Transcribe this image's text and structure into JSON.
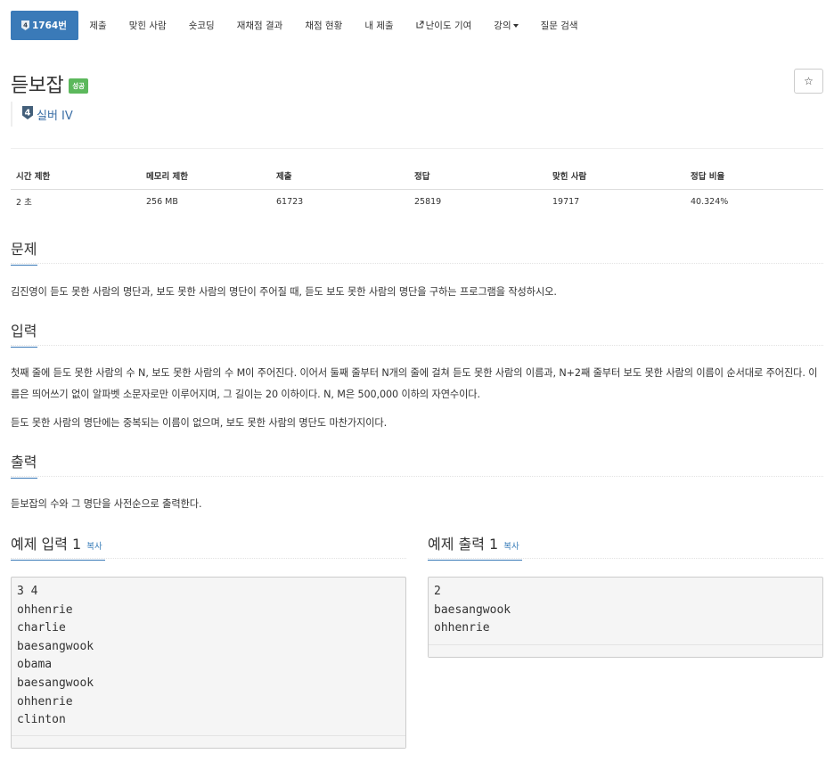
{
  "nav": {
    "problem_number": "1764번",
    "items": [
      "제출",
      "맞힌 사람",
      "숏코딩",
      "재채점 결과",
      "채점 현황",
      "내 제출",
      "난이도 기여",
      "강의",
      "질문 검색"
    ],
    "active_color": "#3a7ab8"
  },
  "problem": {
    "title": "듣보잡",
    "status_badge": "성공",
    "tier_number": "4",
    "tier": "실버 IV",
    "star": "☆"
  },
  "info": {
    "headers": [
      "시간 제한",
      "메모리 제한",
      "제출",
      "정답",
      "맞힌 사람",
      "정답 비율"
    ],
    "values": [
      "2 초",
      "256 MB",
      "61723",
      "25819",
      "19717",
      "40.324%"
    ]
  },
  "sections": {
    "description_title": "문제",
    "description": "김진영이 듣도 못한 사람의 명단과, 보도 못한 사람의 명단이 주어질 때, 듣도 보도 못한 사람의 명단을 구하는 프로그램을 작성하시오.",
    "input_title": "입력",
    "input_p1": "첫째 줄에 듣도 못한 사람의 수 N, 보도 못한 사람의 수 M이 주어진다. 이어서 둘째 줄부터 N개의 줄에 걸쳐 듣도 못한 사람의 이름과, N+2째 줄부터 보도 못한 사람의 이름이 순서대로 주어진다. 이름은 띄어쓰기 없이 알파벳 소문자로만 이루어지며, 그 길이는 20 이하이다. N, M은 500,000 이하의 자연수이다.",
    "input_p2": "듣도 못한 사람의 명단에는 중복되는 이름이 없으며, 보도 못한 사람의 명단도 마찬가지이다.",
    "output_title": "출력",
    "output": "듣보잡의 수와 그 명단을 사전순으로 출력한다."
  },
  "samples": {
    "copy_label": "복사",
    "input_title": "예제 입력 1",
    "input_lines": [
      "3 4",
      "ohhenrie",
      "charlie",
      "baesangwook",
      "obama",
      "baesangwook",
      "ohhenrie",
      "clinton"
    ],
    "output_title": "예제 출력 1",
    "output_lines": [
      "2",
      "baesangwook",
      "ohhenrie"
    ]
  }
}
